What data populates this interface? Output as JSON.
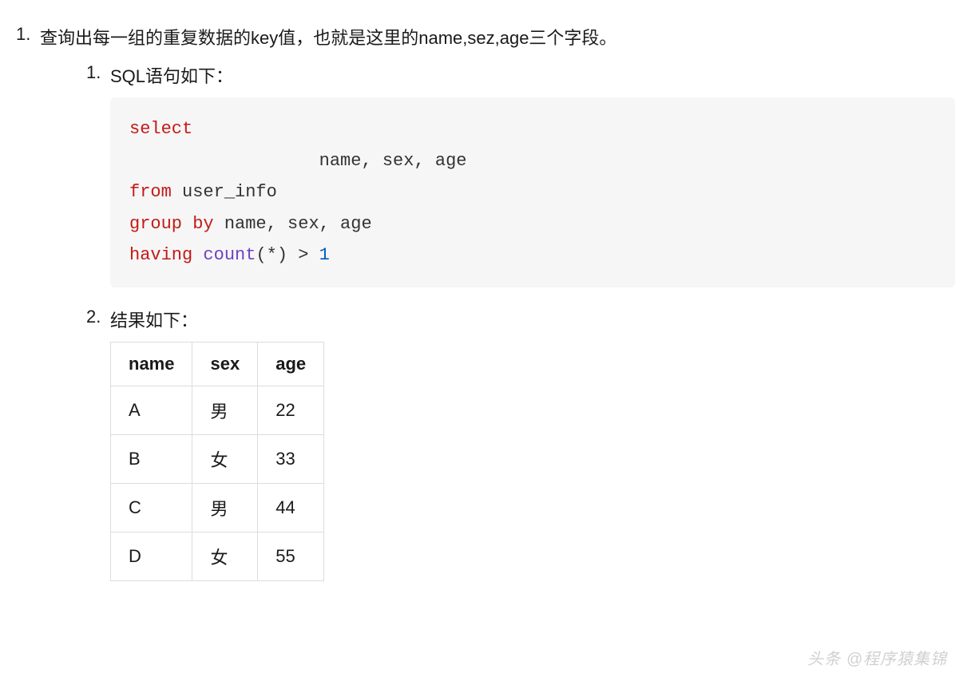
{
  "outer": {
    "item1_text": "查询出每一组的重复数据的key值，也就是这里的name,sez,age三个字段。"
  },
  "inner": {
    "item1_text": "SQL语句如下：",
    "item2_text": "结果如下："
  },
  "code": {
    "kw_select": "select",
    "indent_cols": "                  name, sex, age",
    "kw_from": "from",
    "tbl": " user_info",
    "kw_group": "group",
    "kw_by": " by",
    "grp_cols": " name, sex, age",
    "kw_having": "having",
    "sp1": " ",
    "kw_count": "count",
    "paren_open": "(",
    "star": "*",
    "paren_close": ")",
    "gt": " > ",
    "one": "1"
  },
  "table": {
    "headers": {
      "c0": "name",
      "c1": "sex",
      "c2": "age"
    },
    "rows": [
      {
        "c0": "A",
        "c1": "男",
        "c2": "22"
      },
      {
        "c0": "B",
        "c1": "女",
        "c2": "33"
      },
      {
        "c0": "C",
        "c1": "男",
        "c2": "44"
      },
      {
        "c0": "D",
        "c1": "女",
        "c2": "55"
      }
    ]
  },
  "watermark": "头条 @程序猿集锦"
}
